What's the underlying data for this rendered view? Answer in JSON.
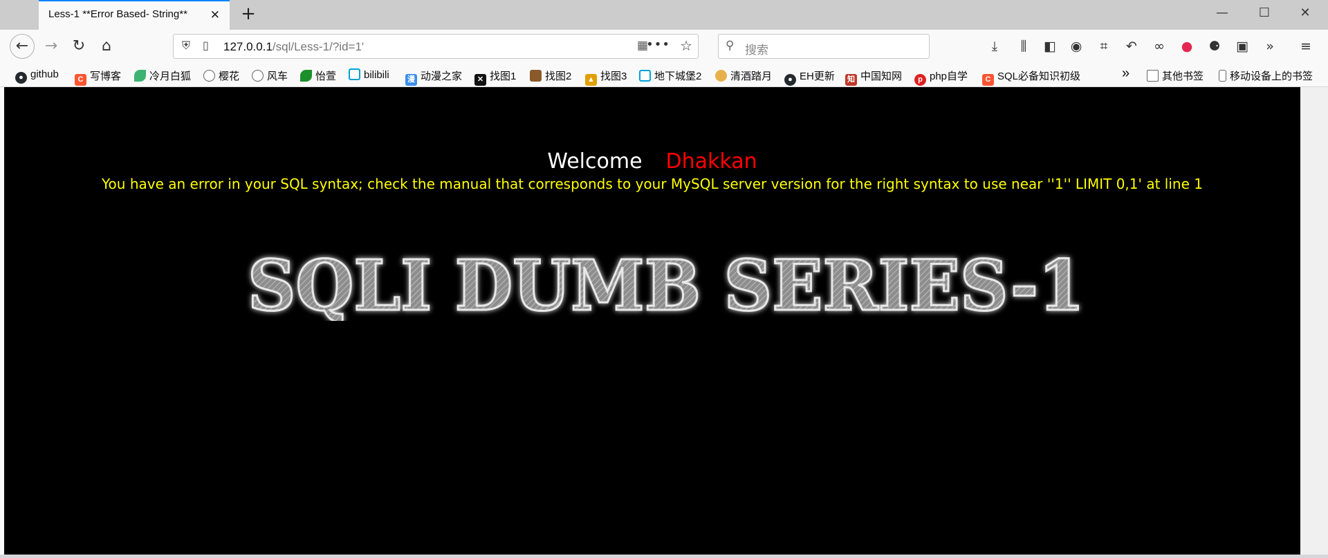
{
  "window": {
    "minimize": "—",
    "maximize": "☐",
    "close": "✕"
  },
  "tab": {
    "title": "Less-1 **Error Based- String**",
    "close": "✕"
  },
  "newtab": "+",
  "url": {
    "host": "127.0.0.1",
    "path": "/sql/Less-1/?id=1'"
  },
  "search": {
    "placeholder": "搜索"
  },
  "bookmarks": [
    {
      "label": "github",
      "color": "#24292e"
    },
    {
      "label": "写博客",
      "color": "#fc5531"
    },
    {
      "label": "冷月白狐",
      "color": "#3cb371"
    },
    {
      "label": "樱花",
      "color": "#666666"
    },
    {
      "label": "风车",
      "color": "#666666"
    },
    {
      "label": "怡萱",
      "color": "#1a8f2a"
    },
    {
      "label": "bilibili",
      "color": "#00a1d6"
    },
    {
      "label": "动漫之家",
      "color": "#3b8eea"
    },
    {
      "label": "找图1",
      "color": "#111111"
    },
    {
      "label": "找图2",
      "color": "#8b5a2b"
    },
    {
      "label": "找图3",
      "color": "#e0a000"
    },
    {
      "label": "地下城堡2",
      "color": "#00a1d6"
    },
    {
      "label": "清酒踏月",
      "color": "#e8b04a"
    },
    {
      "label": "EH更新",
      "color": "#24292e"
    },
    {
      "label": "中国知网",
      "color": "#c0392b"
    },
    {
      "label": "php自学",
      "color": "#e02020"
    },
    {
      "label": "SQL必备知识初级",
      "color": "#fc5531"
    }
  ],
  "bookmarks_more": "»",
  "other_bookmarks": "其他书签",
  "mobile_bookmarks": "移动设备上的书签",
  "page": {
    "welcome": "Welcome",
    "name": "Dhakkan",
    "error": "You have an error in your SQL syntax; check the manual that corresponds to your MySQL server version for the right syntax to use near ''1'' LIMIT 0,1' at line 1",
    "banner": "SQLI DUMB SERIES-1"
  }
}
